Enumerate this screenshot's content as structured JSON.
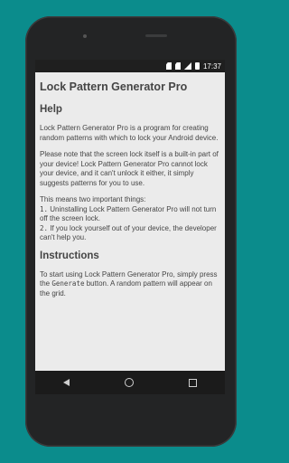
{
  "status_bar": {
    "time": "17:37"
  },
  "app": {
    "title": "Lock Pattern Generator Pro",
    "sections": [
      {
        "heading": "Help",
        "paragraphs": [
          "Lock Pattern Generator Pro is a program for creating random patterns with which to lock your Android device.",
          "Please note that the screen lock itself is a built-in part of your device! Lock Pattern Generator Pro cannot lock your device, and it can't unlock it either, it simply suggests patterns for you to use.",
          "This means two important things:",
          "1.",
          "Uninstalling Lock Pattern Generator Pro will not turn off the screen lock.",
          "2.",
          "If you lock yourself out of your device, the developer can't help you."
        ]
      },
      {
        "heading": "Instructions",
        "paragraphs": [
          "To start using Lock Pattern Generator Pro, simply press the",
          "Generate",
          "button. A random pattern will appear on the grid."
        ]
      }
    ]
  },
  "nav": {
    "back": "back-icon",
    "home": "home-icon",
    "recent": "recent-apps-icon"
  }
}
